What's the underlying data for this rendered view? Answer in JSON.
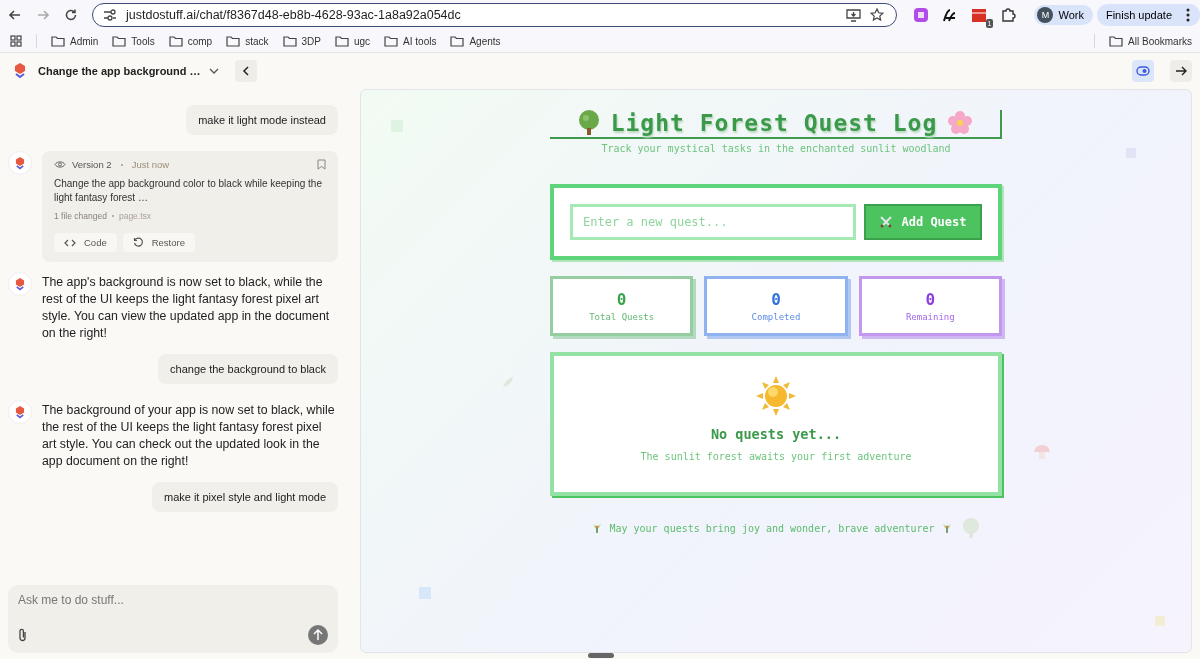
{
  "browser": {
    "url": "justdostuff.ai/chat/f8367d48-eb8b-4628-93ac-1a8a92a054dc",
    "extension_badge": "1",
    "profile": {
      "initial": "M",
      "name": "Work"
    },
    "update_button": "Finish update",
    "bookmarks": [
      "Admin",
      "Tools",
      "comp",
      "stack",
      "3DP",
      "ugc",
      "AI tools",
      "Agents"
    ],
    "all_bookmarks": "All Bookmarks"
  },
  "chat": {
    "title": "Change the app background …",
    "messages": [
      {
        "kind": "user",
        "text": "make it light mode instead"
      },
      {
        "kind": "version",
        "version": "Version 2",
        "time": "Just now",
        "summary": "Change the app background color to black while keeping the light fantasy forest …",
        "files": "1 file changed",
        "file": "page.tsx",
        "actions": [
          "Code",
          "Restore"
        ]
      },
      {
        "kind": "assistant",
        "text": "The app's background is now set to black, while the rest of the UI keeps the light fantasy forest pixel art style. You can view the updated app in the document on the right!"
      },
      {
        "kind": "user",
        "text": "change the background to black"
      },
      {
        "kind": "assistant",
        "text": "The background of your app is now set to black, while the rest of the UI keeps the light fantasy forest pixel art style. You can check out the updated look in the app document on the right!"
      },
      {
        "kind": "user",
        "text": "make it pixel style and light mode"
      }
    ],
    "composer": {
      "placeholder": "Ask me to do stuff..."
    }
  },
  "preview": {
    "title": "Light Forest Quest Log",
    "subtitle": "Track your mystical tasks in the enchanted sunlit woodland",
    "quest_input": {
      "placeholder": "Enter a new quest..."
    },
    "add_button": "Add Quest",
    "stats": [
      {
        "value": "0",
        "label": "Total Quests",
        "color": "#3aa34f"
      },
      {
        "value": "0",
        "label": "Completed",
        "color": "#2f6fe0"
      },
      {
        "value": "0",
        "label": "Remaining",
        "color": "#8a3ee0"
      }
    ],
    "empty": {
      "title": "No quests yet...",
      "text": "The sunlit forest awaits your first adventure"
    },
    "footer": "May your quests bring joy and wonder, brave adventurer"
  }
}
